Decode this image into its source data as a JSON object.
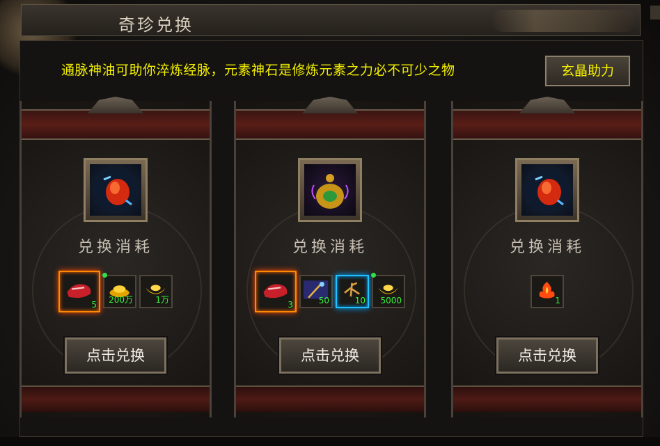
{
  "window": {
    "title": "奇珍兑换"
  },
  "notice": "通脉神油可助你淬炼经脉，元素神石是修炼元素之力必不可少之物",
  "assist_button": "玄晶助力",
  "panels": [
    {
      "reward_icon": "red-gem-icon",
      "cost_label": "兑换消耗",
      "costs": [
        {
          "icon": "red-cloth-icon",
          "count": "5",
          "highlight": "orange"
        },
        {
          "icon": "gold-coins-icon",
          "count": "200万",
          "dot": true
        },
        {
          "icon": "gold-ingot-icon",
          "count": "1万"
        }
      ],
      "button": "点击兑换"
    },
    {
      "reward_icon": "golden-gourd-icon",
      "cost_label": "兑换消耗",
      "costs": [
        {
          "icon": "red-cloth-icon",
          "count": "3",
          "highlight": "orange"
        },
        {
          "icon": "blue-staff-icon",
          "count": "50"
        },
        {
          "icon": "ginseng-root-icon",
          "count": "10",
          "highlight": "blue"
        },
        {
          "icon": "gold-ingot-icon",
          "count": "5000",
          "dot": true
        }
      ],
      "button": "点击兑换"
    },
    {
      "reward_icon": "red-gem-icon",
      "cost_label": "兑换消耗",
      "costs": [
        {
          "icon": "fire-stone-icon",
          "count": "1"
        }
      ],
      "button": "点击兑换"
    }
  ],
  "colors": {
    "notice": "#f4f000",
    "count": "#38f238",
    "highlight_orange": "#ff8a00",
    "highlight_blue": "#1ec4ff"
  }
}
